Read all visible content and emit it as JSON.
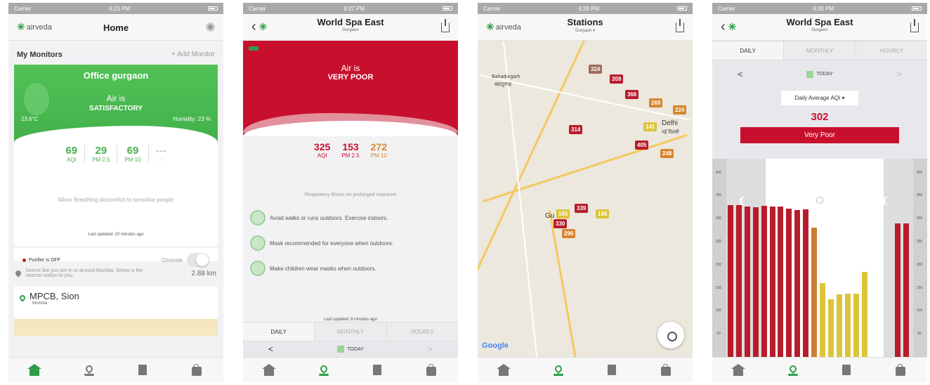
{
  "status_time": [
    "6:23 PM",
    "9:27 PM",
    "6:28 PM",
    "6:30 PM"
  ],
  "carrier": "Carrier",
  "brand": "airveda",
  "p1": {
    "title": "Home",
    "my_monitors": "My Monitors",
    "add_monitor": "+ Add Monitor",
    "monitor_name": "Office gurgaon",
    "air_is": "Air is",
    "status": "SATISFACTORY",
    "temp": "23.6°C",
    "humidity": "Humidity: 23 %",
    "aqi": "69",
    "pm25": "29",
    "pm10": "69",
    "aqi_l": "AQI",
    "pm25_l": "PM 2.5",
    "pm10_l": "PM 10",
    "dash": "---",
    "message": "Minor Breathing discomfort to sensitive people",
    "updated": "Last updated: 20 minutes ago",
    "purifier": "Purifier is OFF",
    "mode": "Ozonate",
    "nearby": "Seems like you are in or around Mumbai. Below is the nearest station to you.",
    "distance": "2.88 km",
    "station": "MPCB, Sion",
    "station_city": "Mumbai"
  },
  "p2": {
    "title": "World Spa East",
    "subtitle": "Gurgaon",
    "air_is": "Air is",
    "status": "VERY POOR",
    "aqi": "325",
    "pm25": "153",
    "pm10": "272",
    "aqi_l": "AQI",
    "pm25_l": "PM 2.5",
    "pm10_l": "PM 10",
    "resp": "Respiratory illness on prolonged exposure",
    "tips": [
      "Avoid walks or runs outdoors. Exercise indoors.",
      "Mask recommended for everyone when outdoors.",
      "Make children wear masks when outdoors."
    ],
    "updated": "Last updated: 8 minutes ago",
    "tabs": [
      "DAILY",
      "MONTHLY",
      "HOURLY"
    ],
    "today": "TODAY",
    "prev": "<",
    "next": ">"
  },
  "p3": {
    "title": "Stations",
    "subtitle": "Gurgaon ▾",
    "google": "Google",
    "labels": [
      "Bahadurgarh",
      "बहादुरगढ़",
      "Delhi",
      "नई दिल्ली",
      "Gu"
    ],
    "markers": [
      {
        "v": "324",
        "c": "br"
      },
      {
        "v": "359",
        "c": "r"
      },
      {
        "v": "366",
        "c": "r"
      },
      {
        "v": "269",
        "c": "o"
      },
      {
        "v": "224",
        "c": "o"
      },
      {
        "v": "314",
        "c": "r"
      },
      {
        "v": "141",
        "c": "y"
      },
      {
        "v": "405",
        "c": "r"
      },
      {
        "v": "248",
        "c": "o"
      },
      {
        "v": "339",
        "c": "r"
      },
      {
        "v": "155",
        "c": "y"
      },
      {
        "v": "156",
        "c": "y"
      },
      {
        "v": "330",
        "c": "r"
      },
      {
        "v": "296",
        "c": "o"
      }
    ]
  },
  "p4": {
    "title": "World Spa East",
    "subtitle": "Gurgaon",
    "tabs": [
      "DAILY",
      "MONTHLY",
      "HOURLY"
    ],
    "today": "TODAY",
    "prev": "<",
    "next": ">",
    "select": "Daily Average AQI ▾",
    "aqi": "302",
    "status": "Very Poor",
    "yticks": [
      "400",
      "350",
      "300",
      "250",
      "200",
      "150",
      "100",
      "50"
    ],
    "chart_data": {
      "type": "bar",
      "values": [
        330,
        329,
        326,
        325,
        328,
        327,
        326,
        322,
        318,
        320,
        280,
        160,
        125,
        135,
        137,
        138,
        185,
        null,
        null,
        null,
        290,
        290
      ],
      "colors": [
        "#b71c2c",
        "#b71c2c",
        "#b71c2c",
        "#b71c2c",
        "#b71c2c",
        "#b71c2c",
        "#b71c2c",
        "#b71c2c",
        "#b71c2c",
        "#b71c2c",
        "#c8802e",
        "#dcc43a",
        "#dcc43a",
        "#dcc43a",
        "#dcc43a",
        "#dcc43a",
        "#dcc43a",
        "",
        "",
        "",
        "#b71c2c",
        "#b71c2c"
      ],
      "ylim": [
        0,
        430
      ]
    }
  }
}
